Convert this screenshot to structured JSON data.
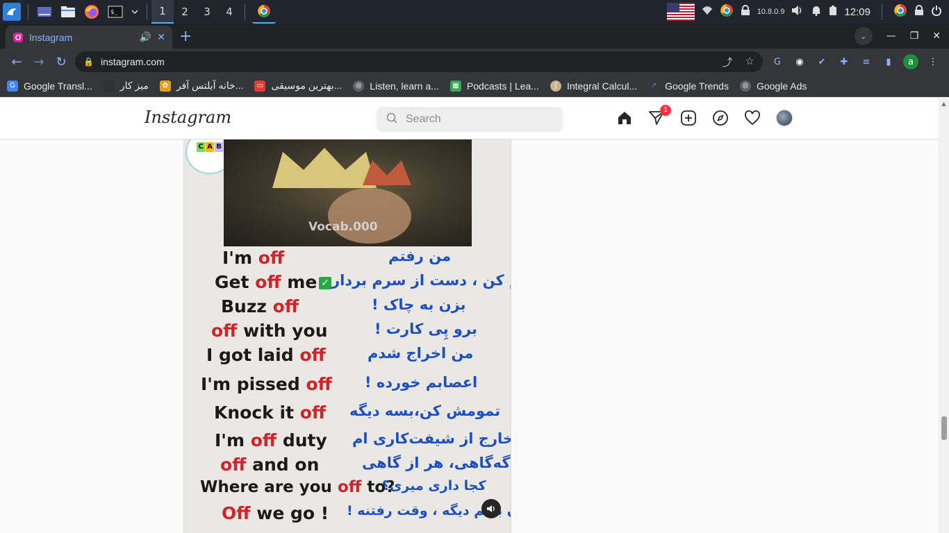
{
  "taskbar": {
    "workspaces": [
      "1",
      "2",
      "3",
      "4"
    ],
    "ip": "10.8.0.9",
    "clock": "12:09"
  },
  "browser": {
    "tab_title": "Instagram",
    "url": "instagram.com",
    "profile_initial": "a",
    "bookmarks": [
      {
        "label": "Google Transl...",
        "icon_color": "#4285f4"
      },
      {
        "label": "میز کار",
        "icon_color": "#303134"
      },
      {
        "label": "خانه آیلتس آفر...",
        "icon_color": "#e3a21a"
      },
      {
        "label": "بهترین موسیقی...",
        "icon_color": "#e53935"
      },
      {
        "label": "Listen, learn a...",
        "icon_color": "#5f6368"
      },
      {
        "label": "Podcasts | Lea...",
        "icon_color": "#34a853"
      },
      {
        "label": "Integral Calcul...",
        "icon_color": "#c9b28a"
      },
      {
        "label": "Google Trends",
        "icon_color": "#4285f4"
      },
      {
        "label": "Google Ads",
        "icon_color": "#5f6368"
      }
    ]
  },
  "instagram": {
    "logo": "Instagram",
    "search_placeholder": "Search",
    "direct_badge": "1",
    "post": {
      "badge_letters": [
        "C",
        "A",
        "B"
      ],
      "watermark": "Vocab.000",
      "rows": [
        {
          "en_pre": "I'm ",
          "en_off": "off",
          "en_post": "",
          "fa": "من رفتم"
        },
        {
          "en_pre": "Get ",
          "en_off": "off",
          "en_post": " me",
          "fa": "وِلَم کن ، دست از سرم بردار"
        },
        {
          "en_pre": "Buzz ",
          "en_off": "off",
          "en_post": "",
          "fa": "بزن به چاک !"
        },
        {
          "en_pre": "",
          "en_off": "off",
          "en_post": " with you",
          "fa": "برو پِی کارت !"
        },
        {
          "en_pre": "I got laid ",
          "en_off": "off",
          "en_post": "",
          "fa": "من اخراج شدم"
        },
        {
          "en_pre": "I'm pissed ",
          "en_off": "off",
          "en_post": "",
          "fa": "اعصابم خورده !"
        },
        {
          "en_pre": "Knock it ",
          "en_off": "off",
          "en_post": "",
          "fa": "تمومش کن،بسه دیگه"
        },
        {
          "en_pre": "I'm ",
          "en_off": "off",
          "en_post": " duty",
          "fa": "خارج از شیفت‌کاری ام"
        },
        {
          "en_pre": "",
          "en_off": "off",
          "en_post": " and on",
          "fa": "گه‌گاهی، هر از گاهی"
        },
        {
          "en_pre": "Where are you ",
          "en_off": "off",
          "en_post": " to?",
          "fa": "کجا داری میری؟"
        },
        {
          "en_pre": "",
          "en_off": "Off",
          "en_post": " we go !",
          "fa": "بزن بریم دیگه ، وقت رفتنه !"
        }
      ]
    }
  }
}
